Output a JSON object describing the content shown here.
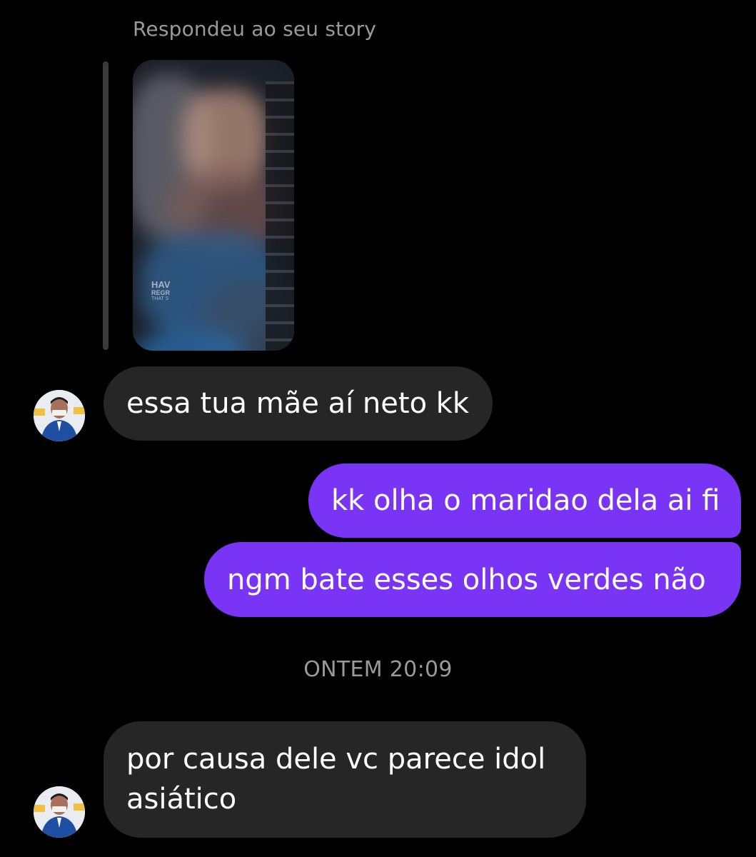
{
  "story_reply": {
    "label": "Respondeu ao seu story",
    "thumbnail": {
      "text_line1": "HAV",
      "text_line2": "REGR",
      "text_line3": "THAT S"
    }
  },
  "messages": [
    {
      "direction": "incoming",
      "text": "essa tua mãe aí neto kk"
    },
    {
      "direction": "outgoing",
      "text": "kk olha o maridao dela ai fi"
    },
    {
      "direction": "outgoing",
      "text": "ngm bate esses olhos verdes não"
    },
    {
      "direction": "incoming",
      "text": "por causa dele vc parece idol asiático"
    }
  ],
  "timestamp": "ONTEM 20:09",
  "colors": {
    "background": "#000000",
    "incoming_bubble": "#262626",
    "outgoing_bubble": "#7a34f5",
    "meta_text": "#9a9a9a"
  },
  "icons": {
    "contact_avatar": "avatar"
  }
}
